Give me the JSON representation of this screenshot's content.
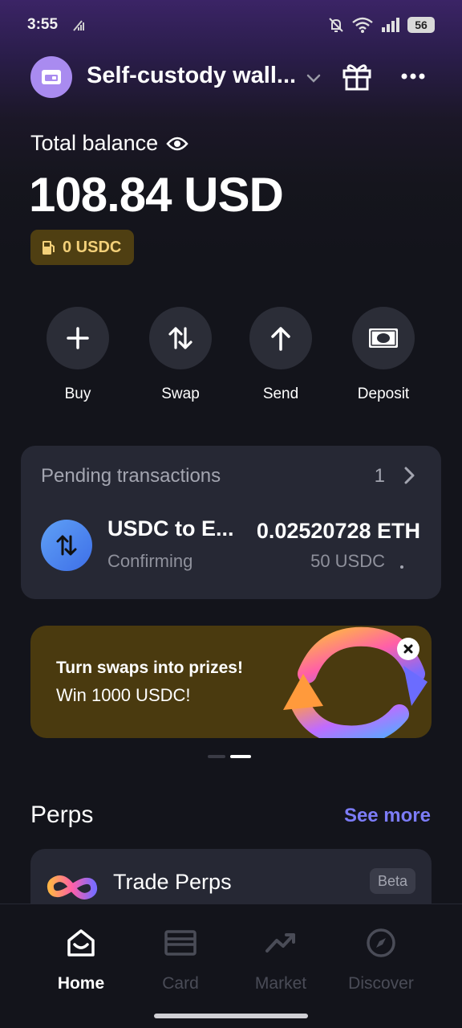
{
  "status_bar": {
    "time": "3:55",
    "battery": "56"
  },
  "header": {
    "wallet_name": "Self-custody wall...",
    "icons": [
      "wallet-icon",
      "chevron-down-icon",
      "gift-icon",
      "more-icon"
    ]
  },
  "balance": {
    "label": "Total balance",
    "value": "108.84 USD",
    "gas_badge": "0 USDC"
  },
  "actions": [
    {
      "label": "Buy",
      "icon": "plus-icon"
    },
    {
      "label": "Swap",
      "icon": "swap-icon"
    },
    {
      "label": "Send",
      "icon": "arrow-up-icon"
    },
    {
      "label": "Deposit",
      "icon": "cash-icon"
    }
  ],
  "pending": {
    "title": "Pending transactions",
    "count": "1",
    "transaction": {
      "name": "USDC to E...",
      "status": "Confirming",
      "amount": "0.02520728 ETH",
      "sub_amount": "50 USDC"
    }
  },
  "promo": {
    "title": "Turn swaps into prizes!",
    "subtitle": "Win 1000 USDC!"
  },
  "perps": {
    "title": "Perps",
    "see_more": "See more",
    "card_title": "Trade Perps",
    "badge": "Beta"
  },
  "nav": [
    {
      "label": "Home",
      "icon": "home-icon",
      "active": true
    },
    {
      "label": "Card",
      "icon": "card-icon",
      "active": false
    },
    {
      "label": "Market",
      "icon": "trend-icon",
      "active": false
    },
    {
      "label": "Discover",
      "icon": "compass-icon",
      "active": false
    }
  ],
  "colors": {
    "background": "#13141b",
    "card": "#262834",
    "accent": "#7c7cf7",
    "gas_badge_bg": "#4f3f12",
    "gas_badge_text": "#f3d079",
    "promo_bg": "#4a3a0f"
  }
}
